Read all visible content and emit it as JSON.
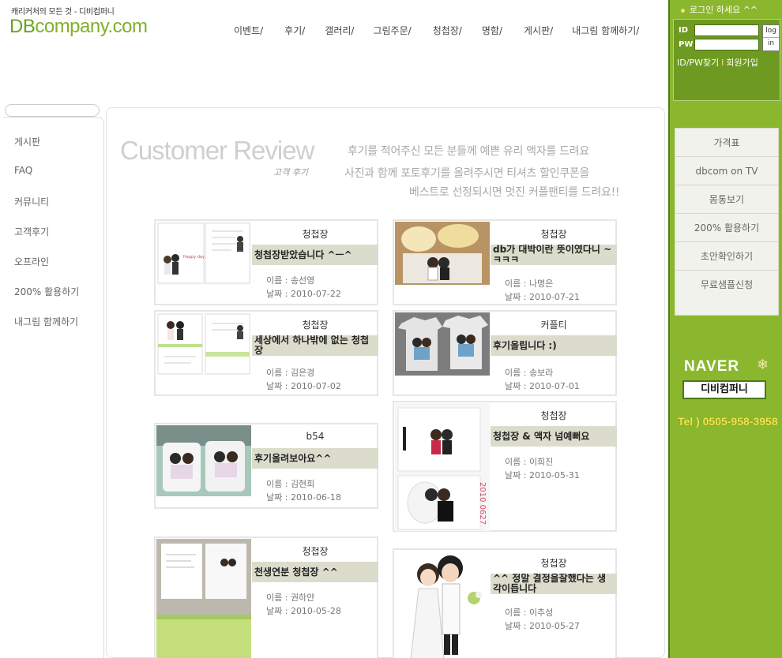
{
  "header": {
    "tagline": "캐리커처의 모든 것 - 디비컴퍼니",
    "logo_db": "DB",
    "logo_rest": "company.com",
    "nav": [
      "이벤트/",
      "후기/",
      "갤러리/",
      "그림주문/",
      "청첩장/",
      "명함/",
      "게시판/",
      "내그림 함께하기/"
    ]
  },
  "left_nav": [
    "게시판",
    "FAQ",
    "커뮤니티",
    "고객후기",
    "오프라인",
    "200% 활용하기",
    "내그림 함께하기"
  ],
  "page": {
    "title": "Customer Review",
    "subtitle": "고객 후기",
    "promo": [
      "후기를 적어주신 모든 분들께  예쁜 유리 액자를 드려요",
      "사진과 함께 포토후기를 올려주시면 티셔츠 할인쿠폰을",
      "베스트로 선정되시면 멋진 커플팬티를 드려요!!"
    ]
  },
  "reviews": [
    {
      "category": "청첩장",
      "subject": "청첩장받았습니다 ^ㅡ^",
      "name": "이름 : 송선영",
      "date": "날짜 : 2010-07-22"
    },
    {
      "category": "청첩장",
      "subject": "db가 대박이란 뜻이였다니 ~ㅋㅋㅋ",
      "name": "이름 : 나명은",
      "date": "날짜 : 2010-07-21"
    },
    {
      "category": "청첩장",
      "subject": "세상에서 하나밖에 없는 청첩장",
      "name": "이름 : 김은경",
      "date": "날짜 : 2010-07-02"
    },
    {
      "category": "커플티",
      "subject": "후기올립니다 :)",
      "name": "이름 : 송보라",
      "date": "날짜 : 2010-07-01"
    },
    {
      "category": "b54",
      "subject": "후기올려보아요^^",
      "name": "이름 : 김현희",
      "date": "날짜 : 2010-06-18"
    },
    {
      "category": "청첩장",
      "subject": "청첩장 & 액자 넘예뻐요",
      "name": "이름 : 이희진",
      "date": "날짜 : 2010-05-31"
    },
    {
      "category": "청첩장",
      "subject": "천생연분 청첩장 ^^",
      "name": "이름 : 권하얀",
      "date": "날짜 : 2010-05-28"
    },
    {
      "category": "청첩장",
      "subject": "^^ 정말 결정을잘했다는 생각이듭니다",
      "name": "이름 : 이추성",
      "date": "날짜 : 2010-05-27"
    }
  ],
  "login": {
    "title": "로그인 하세요 ^^",
    "id_label": "ID",
    "pw_label": "PW",
    "btn_top": "log",
    "btn_bottom": "in",
    "find": "ID/PW찾기",
    "sep": "I",
    "join": "회원가입"
  },
  "side_menu": [
    "가격표",
    "dbcom on TV",
    "몸통보기",
    "200% 활용하기",
    "초안확인하기",
    "무료샘플신청"
  ],
  "naver": {
    "logo": "NAVER",
    "search_text": "디비컴퍼니"
  },
  "tel": "Tel ) 0505-958-3958",
  "colors": {
    "accent_green": "#8bb72e",
    "logo_green": "#7fb02a",
    "subject_bg": "#dcdccd",
    "tel_yellow": "#f5e34a"
  }
}
